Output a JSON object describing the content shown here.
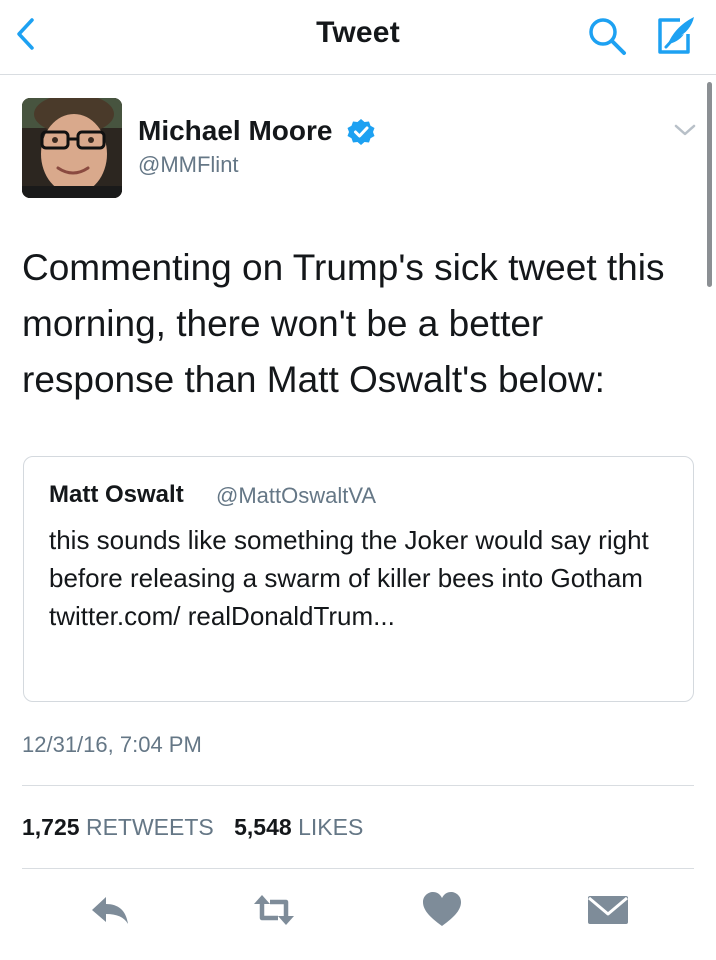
{
  "nav": {
    "title": "Tweet",
    "icons": [
      "back-chevron-icon",
      "search-icon",
      "compose-icon"
    ]
  },
  "tweet": {
    "author": {
      "name": "Michael Moore",
      "handle": "@MMFlint",
      "verified": true
    },
    "text": "Commenting on Trump's sick tweet this morning, there won't be a better response than Matt Oswalt's below:",
    "quoted": {
      "name": "Matt Oswalt",
      "handle": "@MattOswaltVA",
      "text": "this sounds like something the Joker would say right before releasing a swarm of killer bees into Gotham twitter.com/ realDonaldTrum..."
    },
    "timestamp": "12/31/16, 7:04 PM",
    "stats": {
      "retweets": "1,725",
      "retweets_label": "RETWEETS",
      "likes": "5,548",
      "likes_label": "LIKES"
    },
    "actions": [
      "reply-icon",
      "retweet-icon",
      "like-icon",
      "direct-message-icon"
    ]
  },
  "colors": {
    "accent": "#1da1f2",
    "text": "#14171a",
    "secondary": "#657786",
    "divider": "#d9dde1",
    "action_icon": "#7e8c99"
  }
}
